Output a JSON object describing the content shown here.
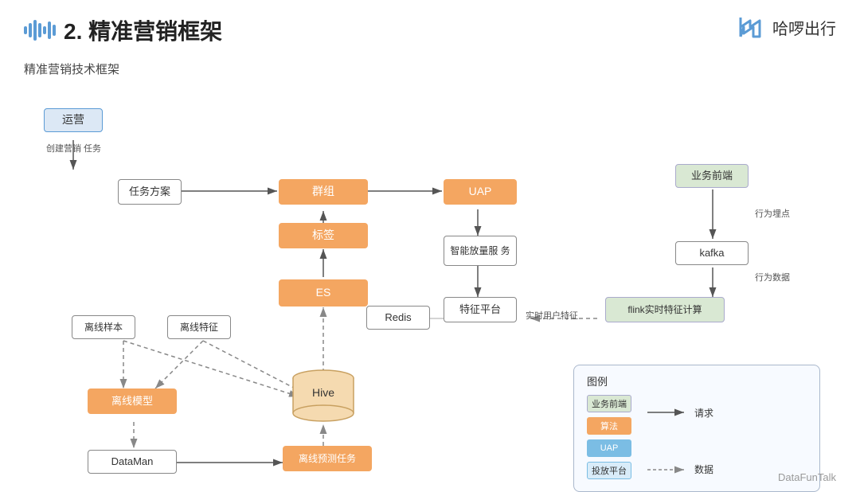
{
  "header": {
    "title": "2. 精准营销框架",
    "subtitle": "精准营销技术框架"
  },
  "logo": {
    "text": "哈啰出行"
  },
  "nodes": {
    "yunying": "运营",
    "renwufangan": "任务方案",
    "qunzu": "群组",
    "biaoqian": "标签",
    "es": "ES",
    "hive": "Hive",
    "uap": "UAP",
    "zhineng": "智能放量服\n务",
    "tezhengpingtai": "特征平台",
    "redis": "Redis",
    "lixianyangben": "离线样本",
    "lixiantezheng": "离线特征",
    "lixianmoxing": "离线模型",
    "dataman": "DataMan",
    "lixianyuce": "离线预测任务",
    "yewuqianduan": "业务前端",
    "kafka": "kafka",
    "flinkjisuan": "flink实时特征计算",
    "chuangjian": "创建营销\n任务",
    "hangweimaizi": "行为埋点",
    "hangweidashuju": "行为数据",
    "shishitezheng": "实时用户特征"
  },
  "legend": {
    "title": "图例",
    "items": [
      {
        "label": "业务前端",
        "type": "green"
      },
      {
        "label": "算法",
        "type": "orange"
      },
      {
        "label": "UAP",
        "type": "blue"
      },
      {
        "label": "投放平台",
        "type": "outline"
      }
    ],
    "arrows": [
      {
        "label": "请求",
        "type": "solid"
      },
      {
        "label": "数据",
        "type": "dashed"
      }
    ]
  },
  "watermark": "DataFunTalk"
}
